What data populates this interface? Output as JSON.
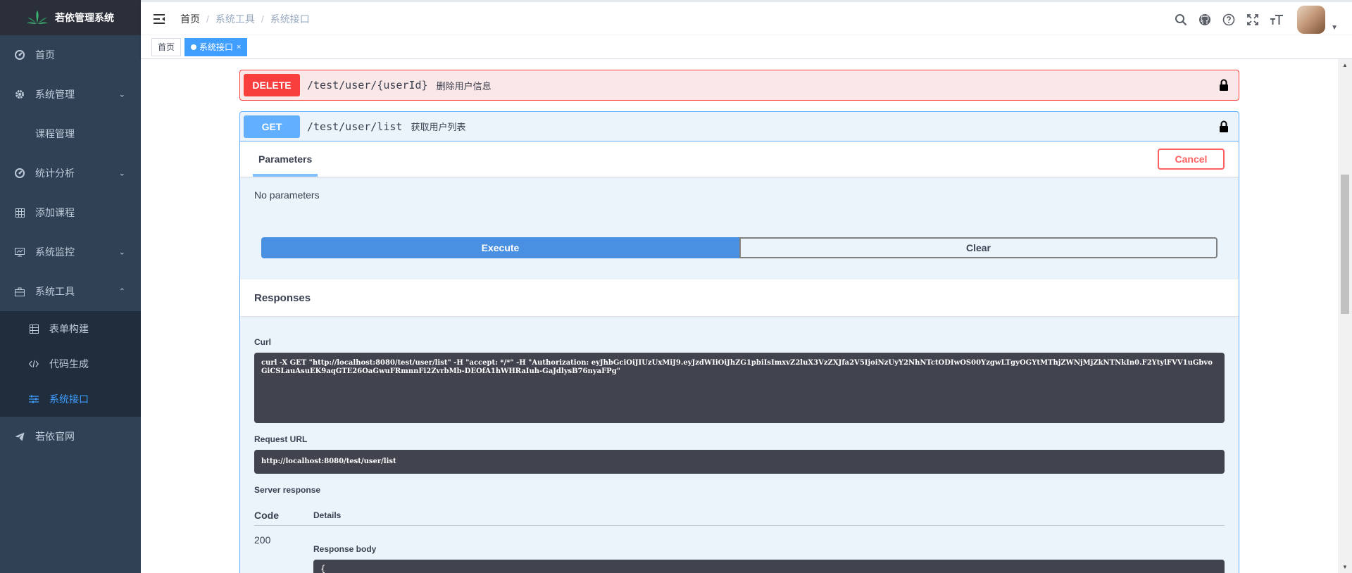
{
  "app": {
    "title": "若依管理系统"
  },
  "sidebar": {
    "items": [
      {
        "label": "首页",
        "icon": "dashboard-icon"
      },
      {
        "label": "系统管理",
        "icon": "gear-icon",
        "expandable": true
      },
      {
        "label": "课程管理",
        "icon": ""
      },
      {
        "label": "统计分析",
        "icon": "dashboard-icon",
        "expandable": true
      },
      {
        "label": "添加课程",
        "icon": "grid-icon"
      },
      {
        "label": "系统监控",
        "icon": "monitor-icon",
        "expandable": true
      },
      {
        "label": "系统工具",
        "icon": "toolbox-icon",
        "expanded": true
      }
    ],
    "tool_sub": [
      {
        "label": "表单构建",
        "icon": "table-icon"
      },
      {
        "label": "代码生成",
        "icon": "code-icon"
      },
      {
        "label": "系统接口",
        "icon": "sliders-icon",
        "active": true
      }
    ],
    "bottom": {
      "label": "若依官网",
      "icon": "send-icon"
    }
  },
  "breadcrumb": [
    "首页",
    "系统工具",
    "系统接口"
  ],
  "tags": [
    {
      "label": "首页"
    },
    {
      "label": "系统接口",
      "active": true
    }
  ],
  "delete_op": {
    "method": "DELETE",
    "path": "/test/user/{userId}",
    "summary": "删除用户信息"
  },
  "get_op": {
    "method": "GET",
    "path": "/test/user/list",
    "summary": "获取用户列表",
    "params_tab": "Parameters",
    "cancel_label": "Cancel",
    "no_params": "No parameters",
    "execute_label": "Execute",
    "clear_label": "Clear",
    "responses_label": "Responses",
    "curl_label": "Curl",
    "curl_text": "curl -X GET \"http://localhost:8080/test/user/list\" -H \"accept: */*\" -H \"Authorization: eyJhbGciOiJIUzUxMiJ9.eyJzdWIiOiJhZG1pbiIsImxvZ2luX3VzZXJfa2V5IjoiNzUyY2NhNTctODIwOS00YzgwLTgyOGYtMThjZWNjMjZkNTNkIn0.F2YtylFVV1uGbvoGiCSLauAsuEK9aqGTE26OaGwuFRmnnFi2ZvrbMb-DEOfA1hWHRaIuh-GaJdlysB76nyaFPg\"",
    "request_url_label": "Request URL",
    "request_url": "http://localhost:8080/test/user/list",
    "server_response_label": "Server response",
    "code_header": "Code",
    "details_header": "Details",
    "status_code": "200",
    "response_body_label": "Response body",
    "response_body_start": "{"
  },
  "colors": {
    "sidebar_bg": "#304156",
    "accent": "#409eff",
    "delete": "#f93e3e",
    "get": "#61affe"
  }
}
